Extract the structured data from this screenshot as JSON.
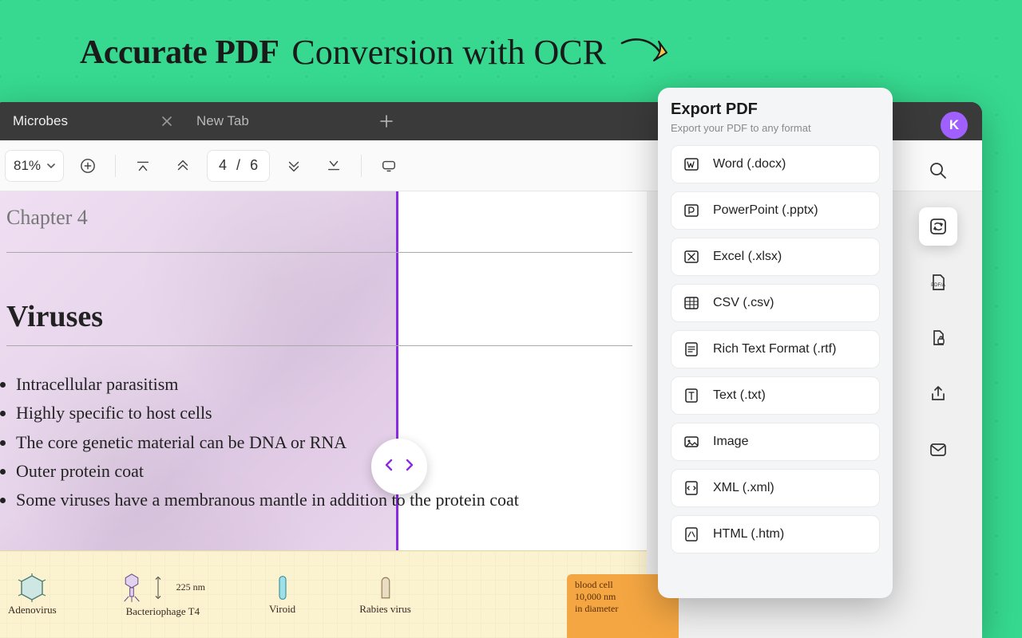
{
  "hero": {
    "bold": "Accurate PDF",
    "script": "Conversion with OCR"
  },
  "tabs": [
    {
      "label": "Microbes",
      "active": true
    },
    {
      "label": "New Tab",
      "active": false
    }
  ],
  "toolbar": {
    "zoom_value": "81%",
    "page_current": "4",
    "page_sep": "/",
    "page_total": "6"
  },
  "document": {
    "chapter": "Chapter 4",
    "section": "Viruses",
    "bullets": [
      "Intracellular parasitism",
      "Highly specific to host cells",
      "The core genetic material can be DNA or RNA",
      "Outer protein coat",
      "Some viruses have a membranous mantle in addition to the protein coat"
    ],
    "diagrams": {
      "adeno": "Adenovirus",
      "bacterio": "Bacteriophage T4",
      "bacterio_dim": "225 nm",
      "viroid": "Viroid",
      "rabies": "Rabies virus"
    },
    "orange_card": {
      "l1": "blood cell",
      "l2": "10,000 nm",
      "l3": "in diameter"
    }
  },
  "export": {
    "title": "Export PDF",
    "subtitle": "Export your PDF to any format",
    "items": [
      "Word (.docx)",
      "PowerPoint (.pptx)",
      "Excel (.xlsx)",
      "CSV (.csv)",
      "Rich Text Format (.rtf)",
      "Text (.txt)",
      "Image",
      "XML (.xml)",
      "HTML (.htm)"
    ]
  },
  "avatar": {
    "letter": "K"
  }
}
